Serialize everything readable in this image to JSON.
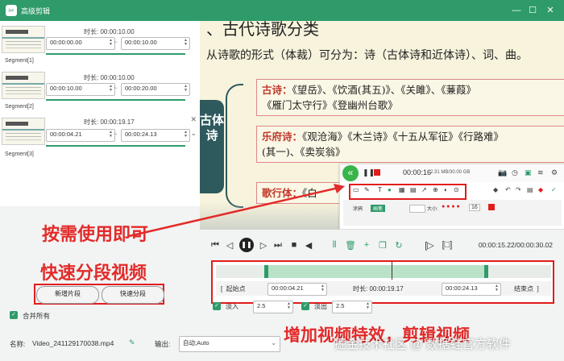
{
  "window": {
    "title": "高级剪辑",
    "min_icon": "minimize-icon",
    "max_icon": "maximize-icon",
    "close_icon": "close-icon"
  },
  "segments": [
    {
      "label": "Segment[1]",
      "duration_label": "时长: 00:00:10.00",
      "start": "00:00:00.00",
      "end": "00:00:10.00",
      "selected": false
    },
    {
      "label": "Segment[2]",
      "duration_label": "时长: 00:00:10.00",
      "start": "00:00:10.00",
      "end": "00:00:20.00",
      "selected": false
    },
    {
      "label": "Segment[3]",
      "duration_label": "时长: 00:00:19.17",
      "start": "00:00:04.21",
      "end": "00:00:24.13",
      "selected": true
    }
  ],
  "left_buttons": {
    "add_segment": "新增片段",
    "quick_split": "快速分段"
  },
  "merge_all": "合并所有",
  "footer": {
    "name_label": "名称:",
    "name_value": "Video_241129170038.mp4",
    "output_label": "输出:",
    "output_value": "自动;Auto"
  },
  "preview": {
    "heading": "、古代诗歌分类",
    "line1": "从诗歌的形式（体裁）可分为：诗（古体诗和近体诗）、词、曲。",
    "category": "古体诗",
    "box1_lead": "古诗：",
    "box1_text": "《望岳》、《饮酒(其五)》、《关雎》、《蒹葭》",
    "box1_line2": "《雁门太守行》《登幽州台歌》",
    "box2_lead": "乐府诗：",
    "box2_text": "《观沧海》《木兰诗》《十五从军征》《行路难》",
    "box2_line2": "(其一)、《卖炭翁》",
    "box3_lead": "歌行体：",
    "box3_text": "《白"
  },
  "recorder": {
    "time": "00:00:16",
    "size": "2.31 MB/30.00 GB",
    "tab1": "涂鸦",
    "tab2": "画笔",
    "width_label": "大小:",
    "font_size": "16"
  },
  "playback": {
    "current_time": "00:00:15.22/00:00:30.02"
  },
  "timeline": {
    "start_btn": "起始点",
    "start_value": "00:00:04.21",
    "duration_label": "时长: 00:00:19.17",
    "end_value": "00:00:24.13",
    "end_btn": "结束点",
    "fade_in_label": "淡入",
    "fade_in_value": "2.5",
    "fade_out_label": "淡出",
    "fade_out_value": "2.5"
  },
  "annotations": {
    "use_as_needed": "按需使用即可",
    "quick_segment": "快速分段视频",
    "add_effects": "增加视频特效，剪辑视频"
  },
  "watermark": "掘金技术社区 @ 数据蛙官方软件",
  "colors": {
    "accent": "#2f9b6a",
    "annotation_red": "#e22b2b",
    "title_green": "#2f9b6a"
  }
}
